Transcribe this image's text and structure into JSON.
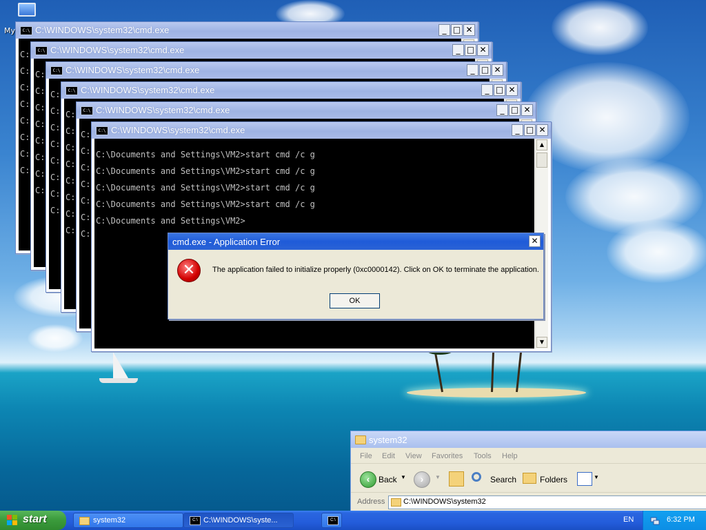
{
  "desktop": {
    "icon_label": "My"
  },
  "cmd_windows": [
    {
      "title": "C:\\WINDOWS\\system32\\cmd.exe",
      "lines": [
        "C:",
        "C:",
        "C:",
        "C:",
        "C:",
        "C:",
        "C:",
        "C:"
      ]
    },
    {
      "title": "C:\\WINDOWS\\system32\\cmd.exe",
      "lines": [
        "C:",
        "C:",
        "C:",
        "C:",
        "C:",
        "C:",
        "C:",
        "C:"
      ]
    },
    {
      "title": "C:\\WINDOWS\\system32\\cmd.exe",
      "lines": [
        "C:\\Documents",
        "C:\\Documents",
        "C:\\Documents",
        "C:",
        "C:",
        "C:",
        "C:",
        "C:"
      ]
    },
    {
      "title": "C:\\WINDOWS\\system32\\cmd.exe",
      "lines": [
        "C:\\Documents",
        "C:",
        "C:",
        "C:",
        "C:",
        "C:",
        "C:",
        "C:"
      ]
    },
    {
      "title": "C:\\WINDOWS\\system32\\cmd.exe",
      "lines": [
        "C:\\Do",
        "C:",
        "C:",
        "C:",
        "C:",
        "C:",
        "C:"
      ]
    },
    {
      "title": "C:\\WINDOWS\\system32\\cmd.exe",
      "lines": [
        "C:\\Documents and Settings\\VM2>start cmd /c g",
        "C:\\Documents and Settings\\VM2>start cmd /c g",
        "C:\\Documents and Settings\\VM2>start cmd /c g",
        "C:\\Documents and Settings\\VM2>start cmd /c g",
        "C:\\Documents and Settings\\VM2>"
      ]
    }
  ],
  "window_buttons": {
    "minimize": "_",
    "maximize": "□",
    "close": "✕"
  },
  "error_dialog": {
    "title": "cmd.exe - Application Error",
    "message": "The application failed to initialize properly (0xc0000142). Click on OK to terminate the application.",
    "ok_label": "OK",
    "icon": "error-x-icon"
  },
  "explorer": {
    "title": "system32",
    "menu": [
      "File",
      "Edit",
      "View",
      "Favorites",
      "Tools",
      "Help"
    ],
    "toolbar": {
      "back": "Back",
      "search": "Search",
      "folders": "Folders"
    },
    "address_label": "Address",
    "address_value": "C:\\WINDOWS\\system32"
  },
  "taskbar": {
    "start_label": "start",
    "tasks": [
      "system32",
      "C:\\WINDOWS\\syste...",
      ""
    ],
    "language": "EN",
    "clock": "6:32 PM"
  },
  "colors": {
    "title_active": "#245edb",
    "title_inactive": "#9fb3e3",
    "start_green": "#3c9c3d",
    "error_red": "#d20000"
  }
}
